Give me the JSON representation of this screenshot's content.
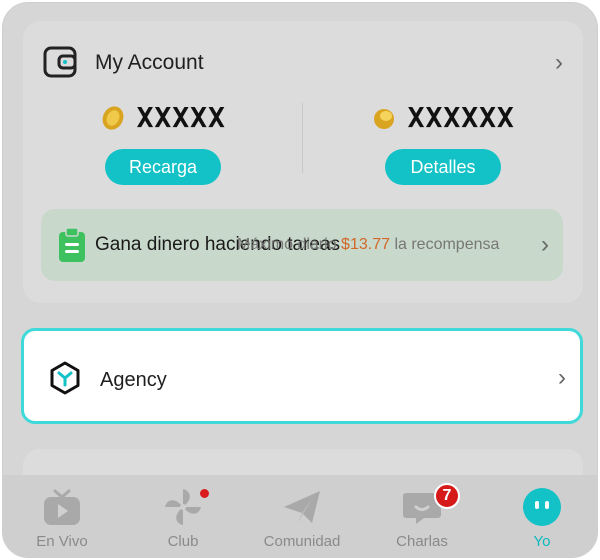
{
  "account": {
    "title": "My Account",
    "coins_left": "XXXXX",
    "coins_right": "XXXXXX",
    "recharge_label": "Recarga",
    "details_label": "Detalles"
  },
  "task": {
    "title": "Gana dinero haciendo tareas",
    "overlay_prefix": "Máximo diario",
    "amount": "$13.77",
    "overlay_suffix": "la recompensa"
  },
  "agency": {
    "label": "Agency"
  },
  "nav": {
    "items": [
      {
        "label": "En Vivo",
        "icon": "tv-play-icon"
      },
      {
        "label": "Club",
        "icon": "pinwheel-icon"
      },
      {
        "label": "Comunidad",
        "icon": "paper-plane-icon"
      },
      {
        "label": "Charlas",
        "icon": "chat-bubble-icon",
        "badge": "7"
      },
      {
        "label": "Yo",
        "icon": "face-icon"
      }
    ]
  },
  "colors": {
    "accent": "#12c2c6",
    "badge": "#d61a1a",
    "amount": "#d2682a"
  }
}
